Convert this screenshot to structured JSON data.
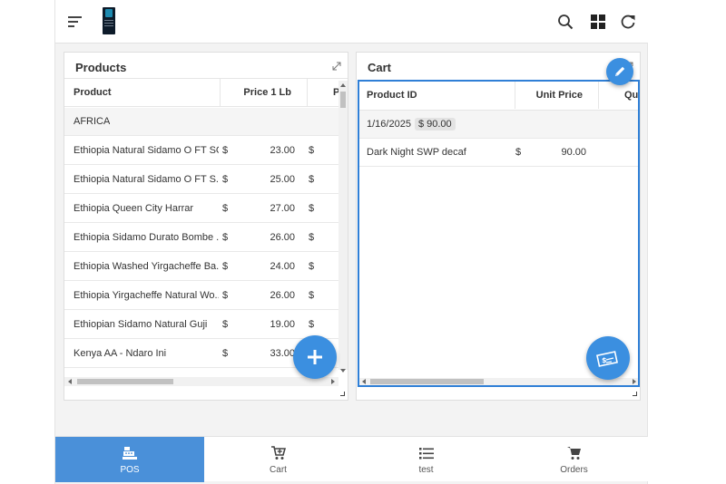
{
  "toolbar": {
    "menu_icon": "hamburger-icon",
    "search_icon": "search-icon",
    "layout_icon": "grid-icon",
    "refresh_icon": "refresh-icon"
  },
  "products": {
    "title": "Products",
    "columns": [
      "Product",
      "Price 1 Lb",
      "P"
    ],
    "group": "AFRICA",
    "rows": [
      {
        "name": "Ethiopia Natural Sidamo O FT SG",
        "cur": "$",
        "price": "23.00",
        "cur2": "$"
      },
      {
        "name": "Ethiopia Natural Sidamo O FT S...",
        "cur": "$",
        "price": "25.00",
        "cur2": "$"
      },
      {
        "name": "Ethiopia Queen City Harrar",
        "cur": "$",
        "price": "27.00",
        "cur2": "$"
      },
      {
        "name": "Ethiopia Sidamo Durato Bombe ...",
        "cur": "$",
        "price": "26.00",
        "cur2": "$"
      },
      {
        "name": "Ethiopia Washed Yirgacheffe Ba...",
        "cur": "$",
        "price": "24.00",
        "cur2": "$"
      },
      {
        "name": "Ethiopia Yirgacheffe Natural Wo...",
        "cur": "$",
        "price": "26.00",
        "cur2": "$"
      },
      {
        "name": "Ethiopian Sidamo Natural Guji",
        "cur": "$",
        "price": "19.00",
        "cur2": "$"
      },
      {
        "name": "Kenya AA - Ndaro Ini",
        "cur": "$",
        "price": "33.00",
        "cur2": ""
      }
    ]
  },
  "cart": {
    "title": "Cart",
    "columns": [
      "Product ID",
      "Unit Price",
      "Qua"
    ],
    "group_date": "1/16/2025",
    "group_total": "$ 90.00",
    "rows": [
      {
        "name": "Dark Night SWP decaf",
        "cur": "$",
        "price": "90.00"
      }
    ]
  },
  "nav": {
    "items": [
      {
        "label": "POS",
        "icon": "cash-register-icon"
      },
      {
        "label": "Cart",
        "icon": "cart-plus-icon"
      },
      {
        "label": "test",
        "icon": "list-icon"
      },
      {
        "label": "Orders",
        "icon": "cart-icon"
      }
    ]
  },
  "colors": {
    "accent": "#4a90d9",
    "fab": "#3b8fe0",
    "selection_border": "#2f7fd6"
  }
}
